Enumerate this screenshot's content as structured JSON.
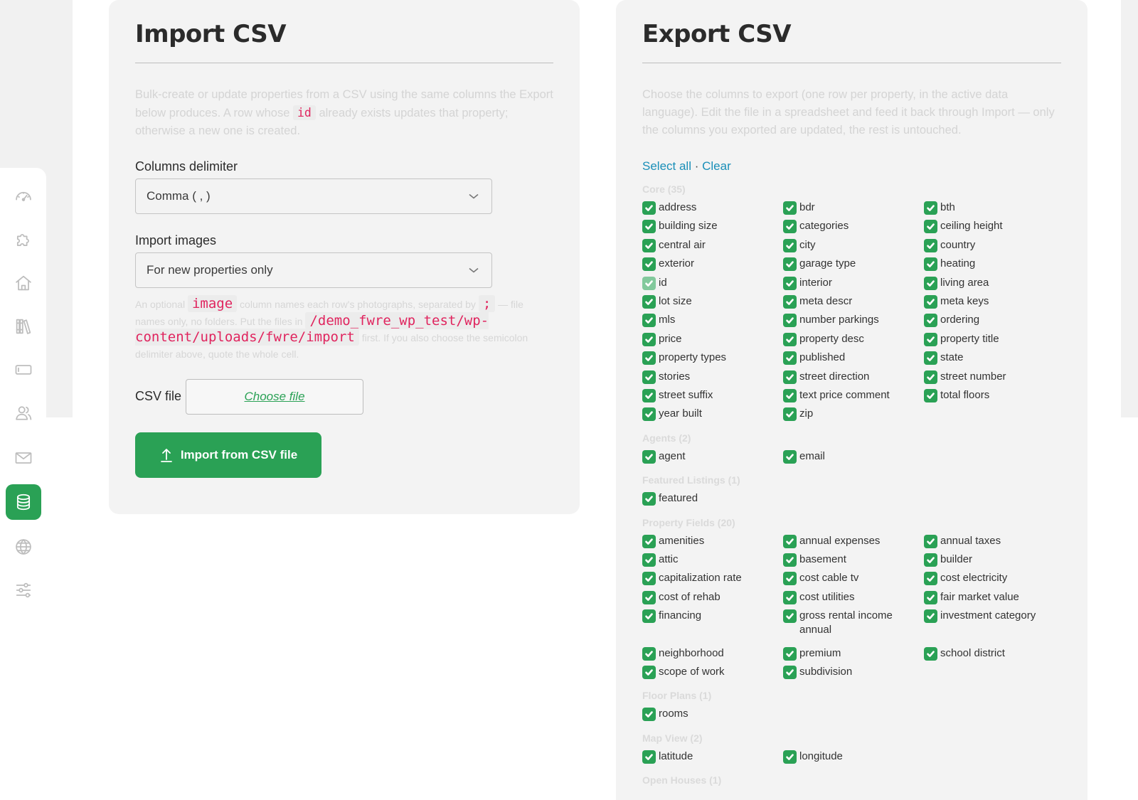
{
  "colors": {
    "accent": "#2aa155",
    "link": "#1a8fb8",
    "code": "#e0245e"
  },
  "sidebar": {
    "items": [
      {
        "icon": "dashboard-icon",
        "active": false
      },
      {
        "icon": "puzzle-icon",
        "active": false
      },
      {
        "icon": "home-icon",
        "active": false
      },
      {
        "icon": "library-icon",
        "active": false
      },
      {
        "icon": "card-icon",
        "active": false
      },
      {
        "icon": "users-icon",
        "active": false
      },
      {
        "icon": "mail-icon",
        "active": false
      },
      {
        "icon": "database-icon",
        "active": true
      },
      {
        "icon": "globe-icon",
        "active": false
      },
      {
        "icon": "sliders-icon",
        "active": false
      }
    ]
  },
  "import": {
    "title": "Import CSV",
    "desc_part1": "Bulk-create or update properties from a CSV using the same columns the Export below produces. A row whose",
    "desc_code": "id",
    "desc_part2": "already exists updates that property; otherwise a new one is created.",
    "delimiter_label": "Columns delimiter",
    "delimiter_value": "Comma ( , )",
    "images_label": "Import images",
    "images_value": "For new properties only",
    "images_help_1": "An optional",
    "images_help_code1": "image",
    "images_help_2": "column names each row's photographs, separated by",
    "images_help_code2": ";",
    "images_help_3": "— file names only, no folders. Put the files in",
    "images_help_code3": "/demo_fwre_wp_test/wp-content/uploads/fwre/import",
    "images_help_4": "first. If you also choose the semicolon delimiter above, quote the whole cell.",
    "csv_label": "CSV file",
    "choose_file": "Choose file",
    "button": "Import from CSV file"
  },
  "export": {
    "title": "Export CSV",
    "desc": "Choose the columns to export (one row per property, in the active data language). Edit the file in a spreadsheet and feed it back through Import — only the columns you exported are updated, the rest is untouched.",
    "select_all": "Select all",
    "separator": "·",
    "clear": "Clear",
    "groups": [
      {
        "name": "Core (35)",
        "options": [
          "address",
          "bdr",
          "bth",
          "building size",
          "categories",
          "ceiling height",
          "central air",
          "city",
          "country",
          "exterior",
          "garage type",
          "heating",
          "id",
          "interior",
          "living area",
          "lot size",
          "meta descr",
          "meta keys",
          "mls",
          "number parkings",
          "ordering",
          "price",
          "property desc",
          "property title",
          "property types",
          "published",
          "state",
          "stories",
          "street direction",
          "street number",
          "street suffix",
          "text price comment",
          "total floors",
          "year built",
          "zip"
        ]
      },
      {
        "name": "Agents (2)",
        "options": [
          "agent",
          "email"
        ]
      },
      {
        "name": "Featured Listings (1)",
        "options": [
          "featured"
        ]
      },
      {
        "name": "Property Fields (20)",
        "options": [
          "amenities",
          "annual expenses",
          "annual taxes",
          "attic",
          "basement",
          "builder",
          "capitalization rate",
          "cost cable tv",
          "cost electricity",
          "cost of rehab",
          "cost utilities",
          "fair market value",
          "financing",
          "gross rental income annual",
          "investment category",
          "neighborhood",
          "premium",
          "school district",
          "scope of work",
          "subdivision"
        ]
      },
      {
        "name": "Floor Plans (1)",
        "options": [
          "rooms"
        ]
      },
      {
        "name": "Map View (2)",
        "options": [
          "latitude",
          "longitude"
        ]
      },
      {
        "name": "Open Houses (1)",
        "options": []
      }
    ]
  }
}
